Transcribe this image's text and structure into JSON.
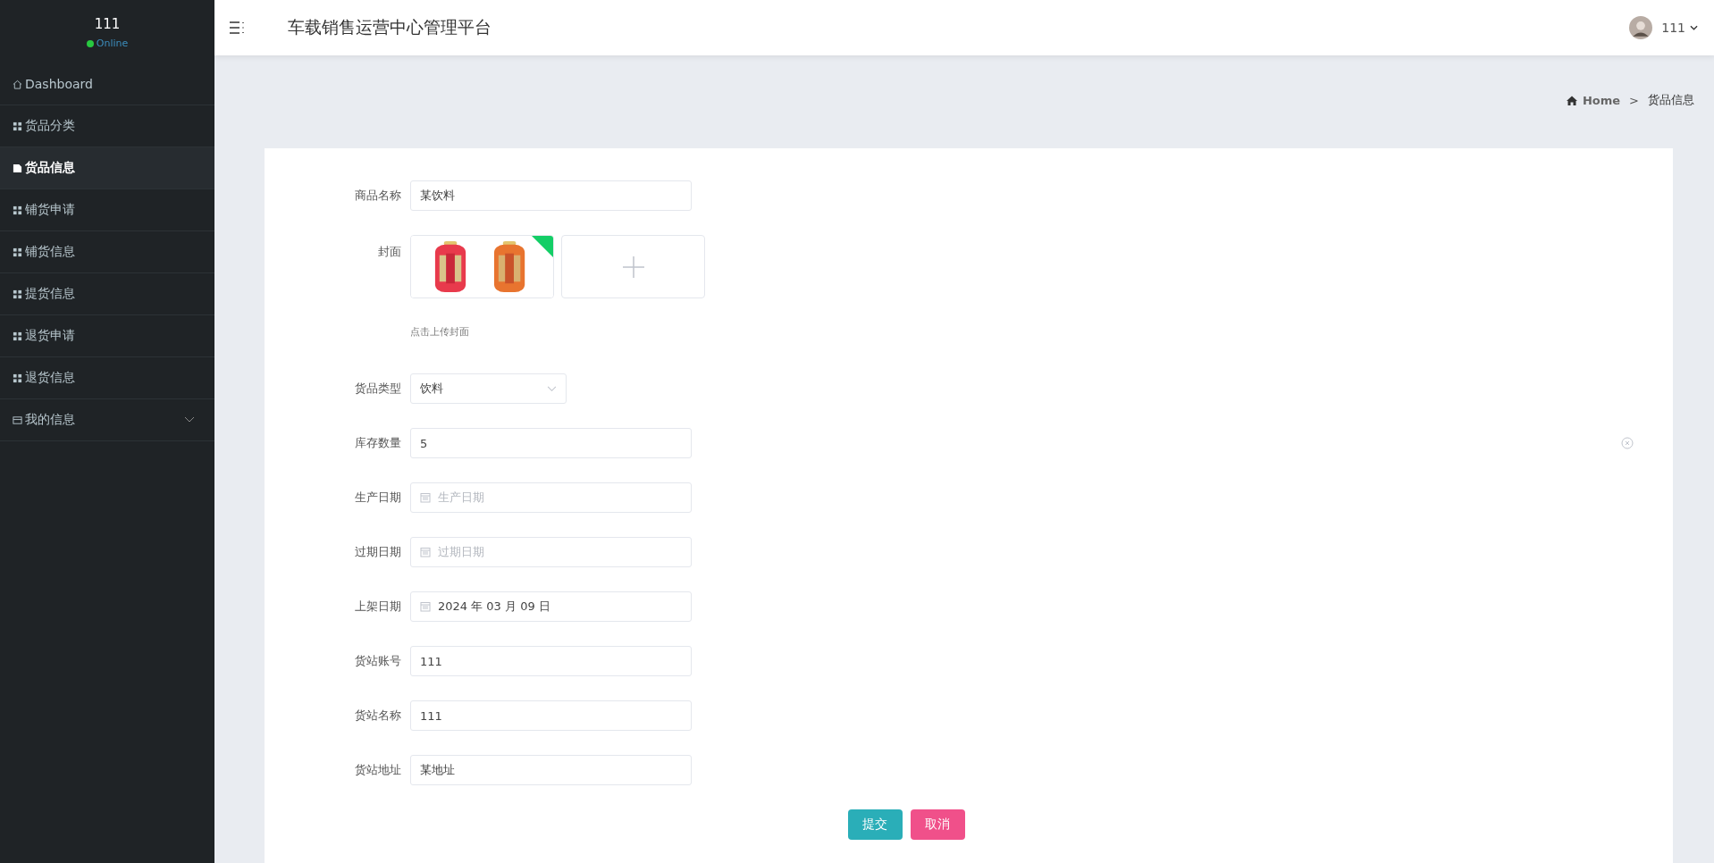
{
  "sidebar": {
    "user": {
      "name": "111",
      "status": "Online"
    },
    "items": [
      {
        "label": "Dashboard",
        "kind": "home",
        "selected": false
      },
      {
        "label": "货品分类",
        "kind": "link",
        "selected": false
      },
      {
        "label": "货品信息",
        "kind": "link",
        "selected": true
      },
      {
        "label": "铺货申请",
        "kind": "link",
        "selected": false
      },
      {
        "label": "铺货信息",
        "kind": "link",
        "selected": false
      },
      {
        "label": "提货信息",
        "kind": "link",
        "selected": false
      },
      {
        "label": "退货申请",
        "kind": "link",
        "selected": false
      },
      {
        "label": "退货信息",
        "kind": "link",
        "selected": false
      },
      {
        "label": "我的信息",
        "kind": "group",
        "selected": false
      }
    ]
  },
  "header": {
    "title": "车载销售运营中心管理平台",
    "user": "111"
  },
  "breadcrumb": {
    "items": [
      {
        "label": "Home",
        "kind": "home"
      },
      {
        "label": "货品信息",
        "kind": "current"
      }
    ],
    "separator": ">"
  },
  "form": {
    "fields": [
      {
        "label": "商品名称",
        "kind": "text",
        "value": "某饮料"
      },
      {
        "label": "封面",
        "kind": "upload",
        "uploaded": true,
        "hint": "点击上传封面"
      },
      {
        "label": "货品类型",
        "kind": "select",
        "value": "饮料"
      },
      {
        "label": "库存数量",
        "kind": "text",
        "value": "5",
        "clearable": true
      },
      {
        "label": "生产日期",
        "kind": "date",
        "placeholder": "生产日期"
      },
      {
        "label": "过期日期",
        "kind": "date",
        "placeholder": "过期日期"
      },
      {
        "label": "上架日期",
        "kind": "date",
        "value": "2024 年 03 月 09 日"
      },
      {
        "label": "货站账号",
        "kind": "text",
        "value": "111"
      },
      {
        "label": "货站名称",
        "kind": "text",
        "value": "111"
      },
      {
        "label": "货站地址",
        "kind": "text",
        "value": "某地址"
      }
    ],
    "buttons": [
      {
        "label": "提交",
        "kind": "primary"
      },
      {
        "label": "取消",
        "kind": "danger"
      }
    ]
  }
}
